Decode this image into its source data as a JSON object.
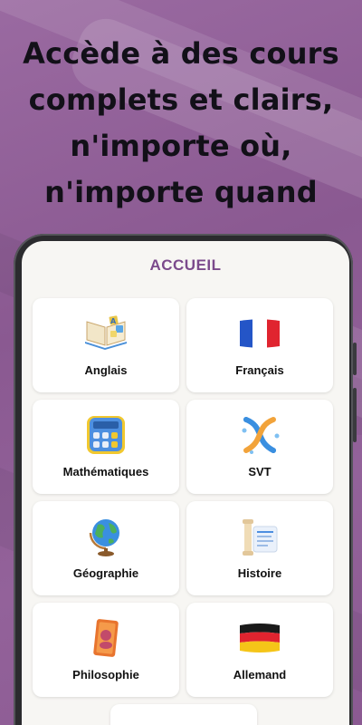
{
  "headline": {
    "line1": "Accède à des cours",
    "line2": "complets et clairs,",
    "line3": "n'importe où,",
    "line4": "n'importe quand"
  },
  "app": {
    "title": "ACCUEIL",
    "subjects": [
      {
        "label": "Anglais",
        "icon": "book-icon"
      },
      {
        "label": "Français",
        "icon": "french-flag-icon"
      },
      {
        "label": "Mathématiques",
        "icon": "calculator-icon"
      },
      {
        "label": "SVT",
        "icon": "dna-icon"
      },
      {
        "label": "Géographie",
        "icon": "globe-icon"
      },
      {
        "label": "Histoire",
        "icon": "scroll-column-icon"
      },
      {
        "label": "Philosophie",
        "icon": "philosophy-book-icon"
      },
      {
        "label": "Allemand",
        "icon": "german-flag-icon"
      }
    ]
  },
  "colors": {
    "background": "#8e5c95",
    "accent": "#7b4a8c",
    "screen": "#f7f6f3"
  }
}
